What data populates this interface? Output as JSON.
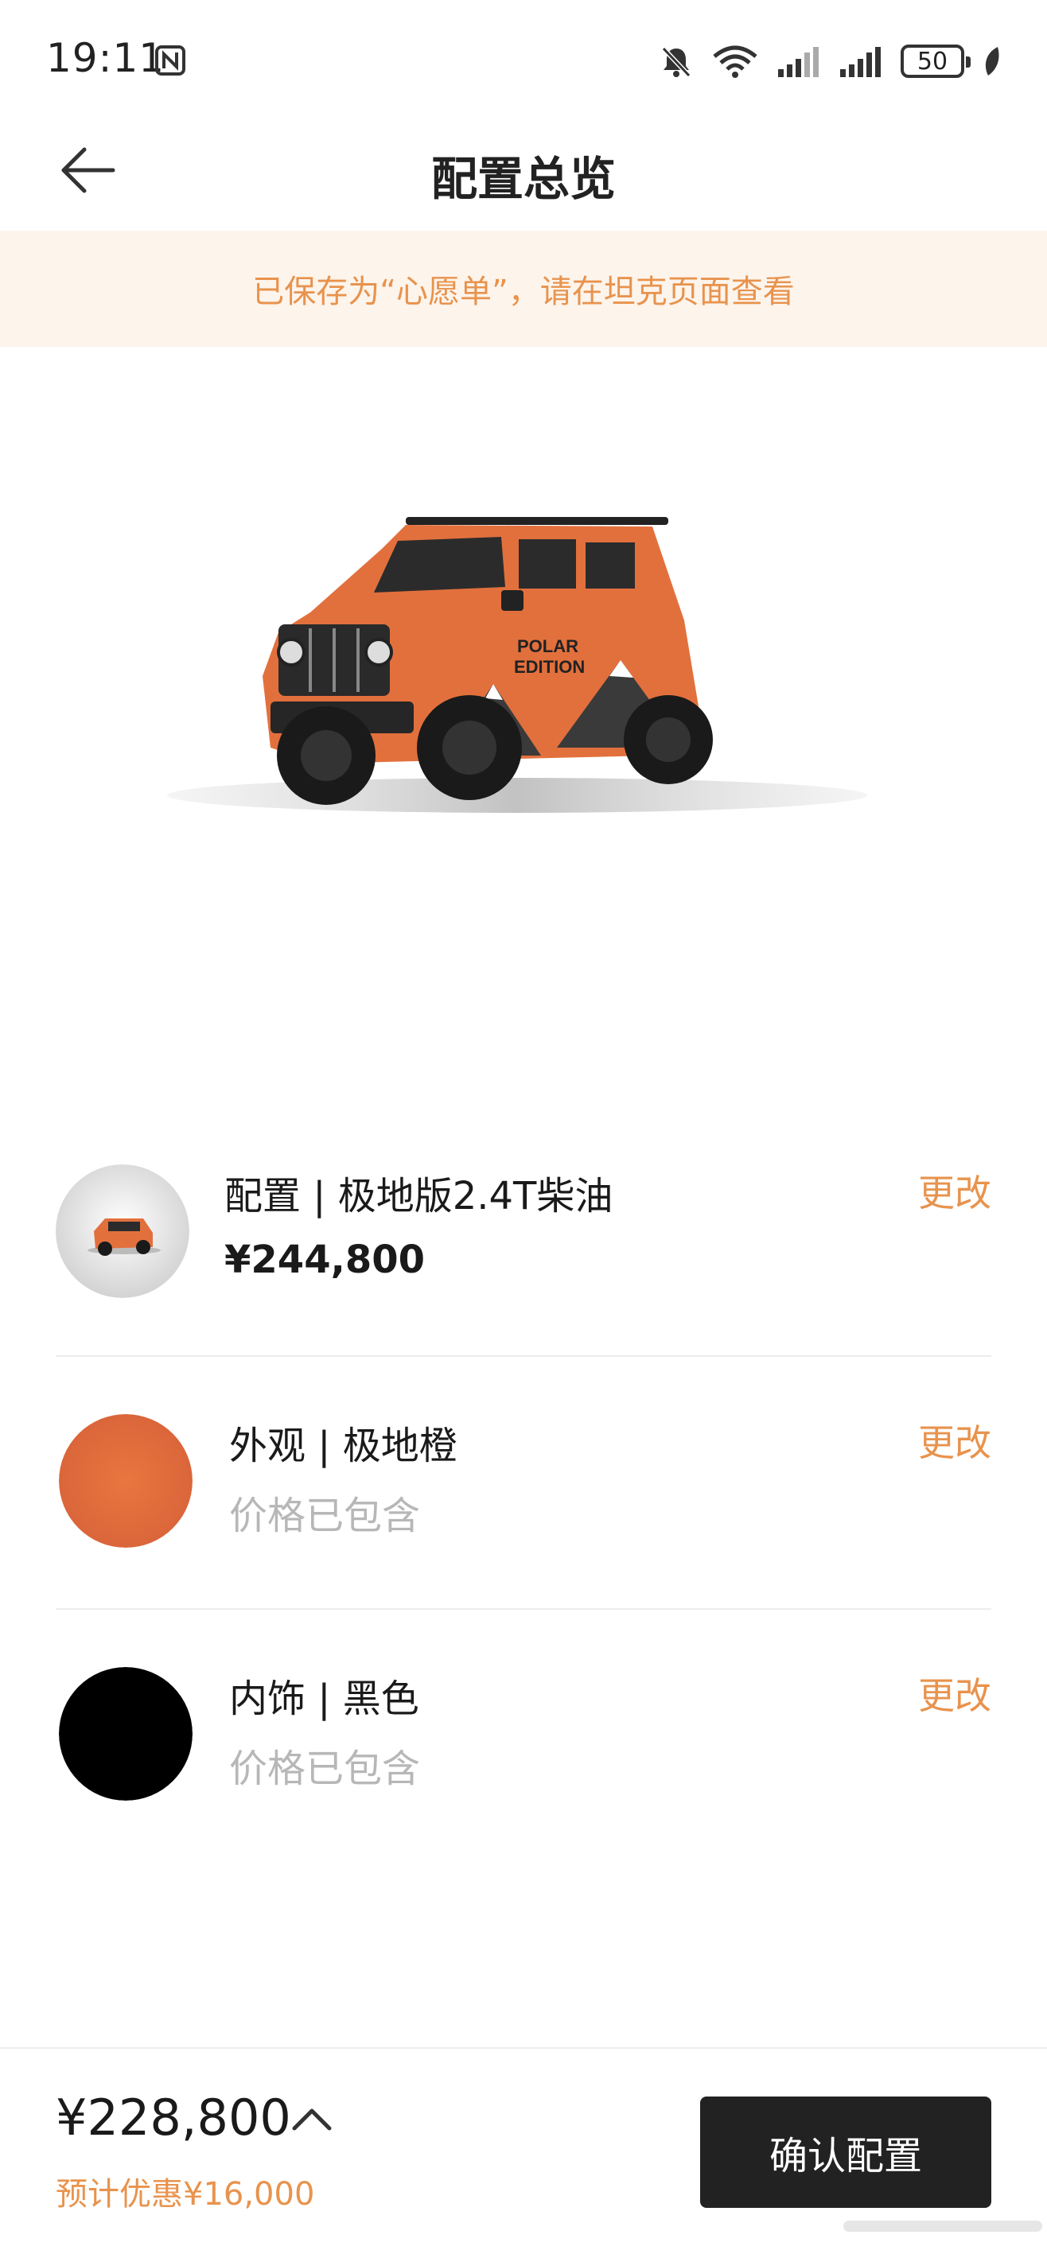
{
  "status_bar": {
    "time": "19:11",
    "battery": "50",
    "icons": [
      "nfc-icon",
      "mute-icon",
      "wifi-icon",
      "signal-icon",
      "signal-icon",
      "battery-icon",
      "leaf-icon"
    ]
  },
  "header": {
    "title": "配置总览",
    "back_icon": "arrow-left-icon"
  },
  "notice": {
    "text": "已保存为“心愿单”，请在坦克页面查看"
  },
  "hero": {
    "image": "car-render-orange-suv"
  },
  "options": [
    {
      "title": "配置 | 极地版2.4T柴油",
      "subtitle": "¥244,800",
      "change": "更改",
      "thumb": "car-thumbnail"
    },
    {
      "title": "外观 | 极地橙",
      "subtitle": "价格已包含",
      "change": "更改",
      "swatch": "#e2703d"
    },
    {
      "title": "内饰 | 黑色",
      "subtitle": "价格已包含",
      "change": "更改",
      "swatch": "#000000"
    }
  ],
  "footer": {
    "total_price": "¥228,800",
    "discount": "预计优惠¥16,000",
    "confirm_button": "确认配置"
  },
  "colors": {
    "accent": "#e8934d",
    "banner_bg": "#fdf4ec",
    "button_bg": "#222222",
    "car_orange": "#e2703d"
  }
}
